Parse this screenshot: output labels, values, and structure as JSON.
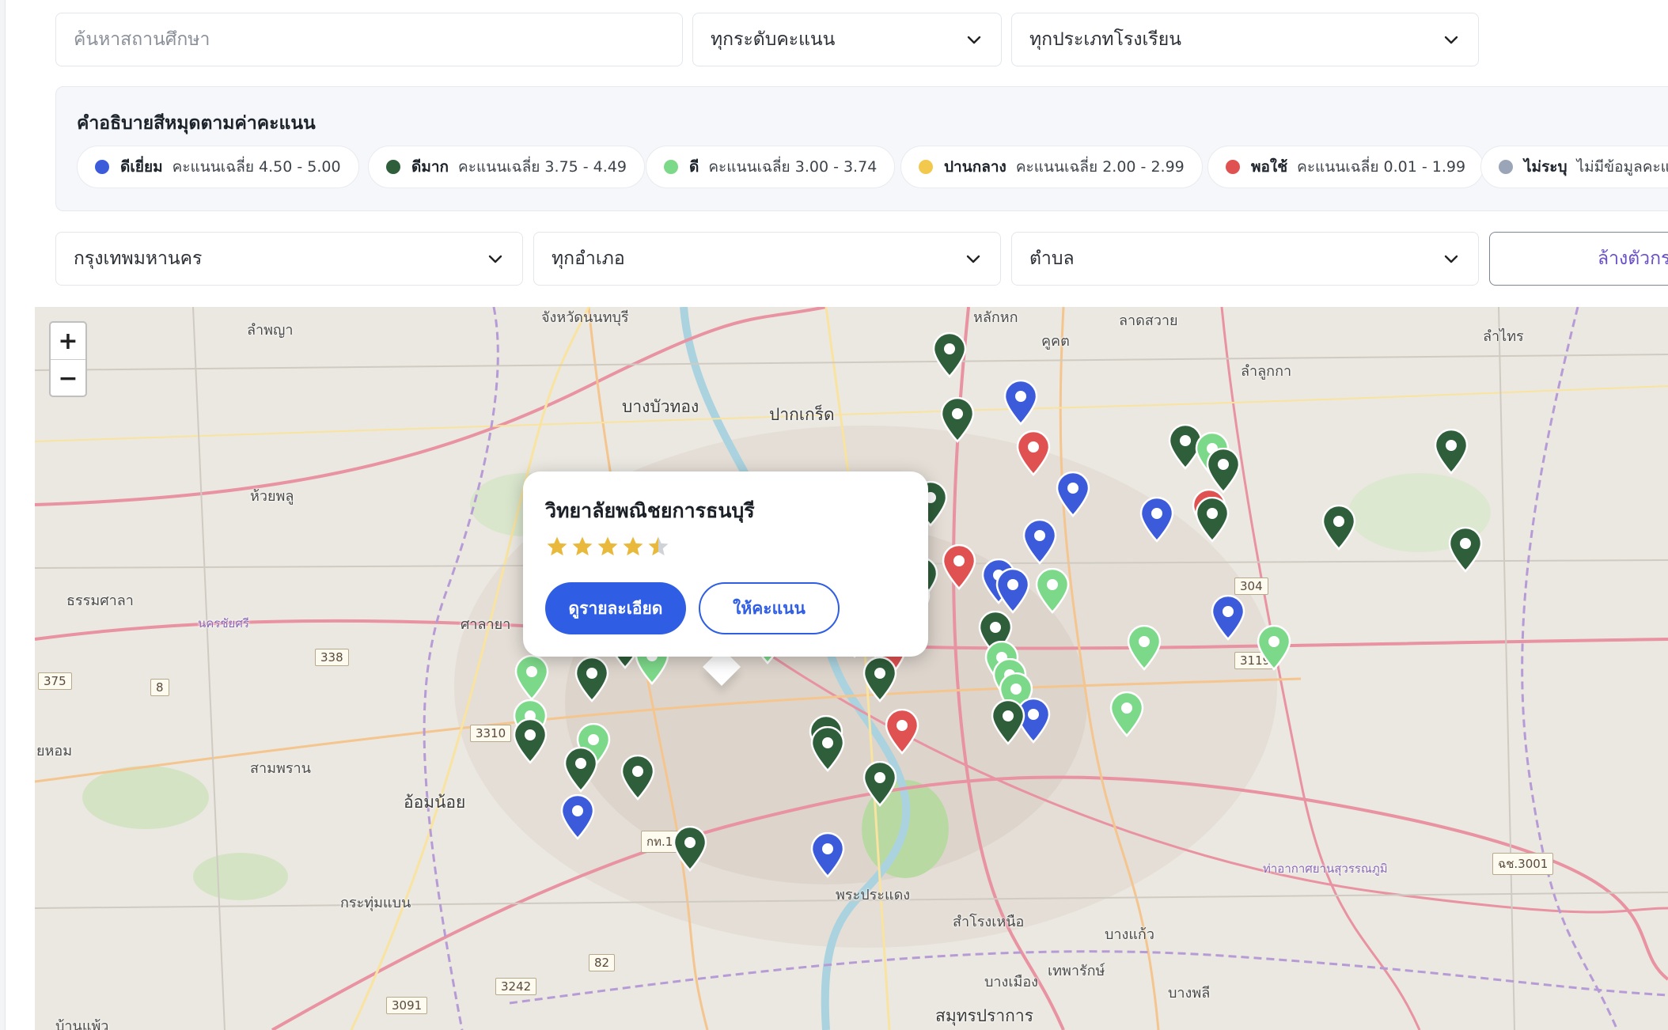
{
  "filters": {
    "search_placeholder": "ค้นหาสถานศึกษา",
    "score_level": "ทุกระดับคะแนน",
    "school_type": "ทุกประเภทโรงเรียน",
    "province": "กรุงเทพมหานคร",
    "district": "ทุกอำเภอ",
    "subdistrict": "ตำบล",
    "clear_label": "ล้างตัวกรอง"
  },
  "legend": {
    "title": "คำอธิบายสีหมุดตามค่าคะแนน",
    "items": [
      {
        "name": "ดีเยี่ยม",
        "range": "คะแนนเฉลี่ย 4.50 - 5.00",
        "color": "#3b5bdb"
      },
      {
        "name": "ดีมาก",
        "range": "คะแนนเฉลี่ย 3.75 - 4.49",
        "color": "#2e5e3a"
      },
      {
        "name": "ดี",
        "range": "คะแนนเฉลี่ย 3.00 - 3.74",
        "color": "#7dd98a"
      },
      {
        "name": "ปานกลาง",
        "range": "คะแนนเฉลี่ย 2.00 - 2.99",
        "color": "#f2c94c"
      },
      {
        "name": "พอใช้",
        "range": "คะแนนเฉลี่ย 0.01 - 1.99",
        "color": "#e05252"
      },
      {
        "name": "ไม่ระบุ",
        "range": "ไม่มีข้อมูลคะแนน",
        "color": "#9aa5b8"
      }
    ]
  },
  "map": {
    "zoom_in": "+",
    "zoom_out": "−",
    "labels": {
      "nonthaburi": "จังหวัดนนทบุรี",
      "lam_phaya": "ลำพญา",
      "bang_bua_thong": "บางบัวทอง",
      "pak_kret": "ปากเกร็ด",
      "huai_phlu": "ห้วยพลู",
      "thammasala": "ธรรมศาลา",
      "sala_ya": "ศาลายา",
      "sam_phran": "สามพราน",
      "om_noi": "อ้อมน้อย",
      "krathum_baen": "กระทุ่มแบน",
      "ban_phaeo": "บ้านแพ้ว",
      "lak_hok": "หลักหก",
      "khu_khot": "คูคต",
      "lat_sawai": "ลาดสวาย",
      "lam_luk_ka": "ลำลูกกา",
      "lam_sai": "ลำไทร",
      "phra_pradaeng": "พระประแดง",
      "samrong_nuea": "สำโรงเหนือ",
      "bang_kaeo": "บางแก้ว",
      "thepharak": "เทพารักษ์",
      "bang_phli": "บางพลี",
      "bang_mueang": "บางเมือง",
      "samut_prakan": "สมุทรปราการ",
      "nakhon_chai_si": "นครชัยศรี",
      "yaohom": "ยหอม",
      "airport": "ท่าอากาศยานสุวรรณภูมิ"
    },
    "road_numbers": [
      "338",
      "375",
      "8",
      "3310",
      "82",
      "3242",
      "3091",
      "304",
      "3119",
      "กท.1001",
      "ฉช.3001"
    ]
  },
  "popup": {
    "school_name": "วิทยาลัยพณิชยการธนบุรี",
    "rating": 4.5,
    "detail_button": "ดูรายละเอียด",
    "rate_button": "ให้คะแนน"
  }
}
